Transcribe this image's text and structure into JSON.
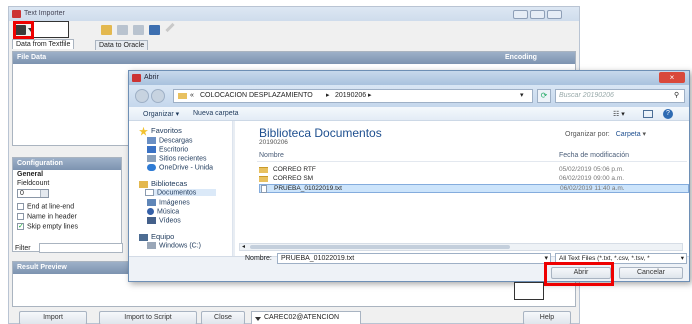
{
  "window": {
    "title": "Text Importer"
  },
  "tabs": [
    "Data from Textfile",
    "Data to Oracle"
  ],
  "file_data": {
    "header": "File Data",
    "encoding_label": "Encoding"
  },
  "configuration": {
    "header": "Configuration",
    "general_label": "General",
    "fieldcount_label": "Fieldcount",
    "fieldcount_value": "0",
    "checkboxes": [
      {
        "label": "End at line-end",
        "checked": false
      },
      {
        "label": "Name in header",
        "checked": false
      },
      {
        "label": "Skip empty lines",
        "checked": true
      }
    ],
    "filter_label": "Filter"
  },
  "result_preview": {
    "header": "Result Preview"
  },
  "bottom_bar": {
    "import": "Import",
    "import_to_script": "Import to Script",
    "close": "Close",
    "connection": "CAREC02@ATENCION",
    "help": "Help"
  },
  "dialog": {
    "title": "Abrir",
    "breadcrumb": [
      "COLOCACION DESPLAZAMIENTO",
      "20190206"
    ],
    "search_placeholder": "Buscar 20190206",
    "organize": "Organizar",
    "new_folder": "Nueva carpeta",
    "library_title": "Biblioteca Documentos",
    "library_subtitle": "20190206",
    "arrange_label": "Organizar por:",
    "arrange_value": "Carpeta",
    "col_name": "Nombre",
    "col_date": "Fecha de modificación",
    "nav": {
      "favorites": "Favoritos",
      "fav_items": [
        "Descargas",
        "Escritorio",
        "Sitios recientes",
        "OneDrive - Unida"
      ],
      "libraries": "Bibliotecas",
      "lib_items": [
        "Documentos",
        "Imágenes",
        "Música",
        "Vídeos"
      ],
      "computer": "Equipo",
      "computer_items": [
        "Windows (C:)"
      ]
    },
    "files": [
      {
        "name": "CORREO RTF",
        "date": "05/02/2019 05:06 p.m.",
        "type": "folder"
      },
      {
        "name": "CORREO SM",
        "date": "06/02/2019 09:00 a.m.",
        "type": "folder"
      },
      {
        "name": "PRUEBA_01022019.txt",
        "date": "06/02/2019 11:40 a.m.",
        "type": "txt",
        "selected": true
      }
    ],
    "filename_label": "Nombre:",
    "filename_value": "PRUEBA_01022019.txt",
    "filetype_value": "All Text Files (*.txt, *.csv, *.tsv, *",
    "open_button": "Abrir",
    "cancel_button": "Cancelar"
  },
  "colors": {
    "highlight": "#e00000",
    "link_blue": "#1e4f8f",
    "selected_row": "#cce4fb"
  }
}
